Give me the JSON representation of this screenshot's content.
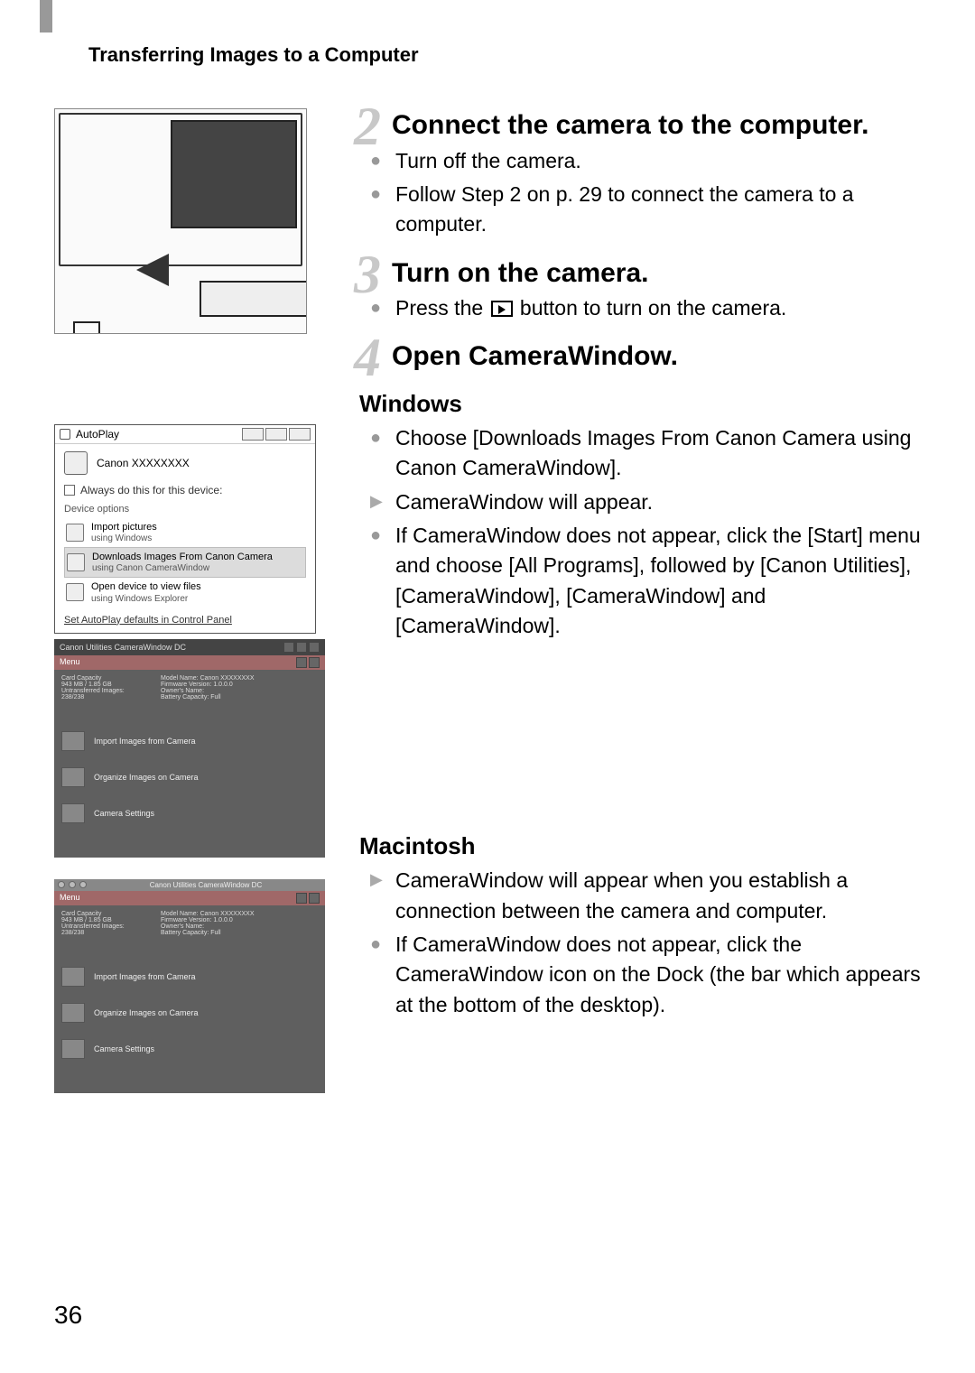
{
  "header": "Transferring Images to a Computer",
  "page_number": "36",
  "steps": {
    "s2": {
      "number": "2",
      "title": "Connect the camera to the computer.",
      "bullets": [
        [
          "Turn off the camera."
        ],
        [
          "Follow Step 2 on ",
          "p. 29",
          " to connect the camera to a computer."
        ]
      ]
    },
    "s3": {
      "number": "3",
      "title": "Turn on the camera.",
      "bullets": [
        [
          "Press the ",
          "PLAY_ICON",
          " button to turn on the camera."
        ]
      ]
    },
    "s4": {
      "number": "4",
      "title": "Open CameraWindow."
    }
  },
  "windows_section": {
    "title": "Windows",
    "bullets": [
      "Choose [Downloads Images From Canon Camera using Canon CameraWindow].",
      "If CameraWindow does not appear, click the [Start] menu and choose [All Programs], followed by [Canon Utilities], [CameraWindow], [CameraWindow] and [CameraWindow]."
    ],
    "triangle": "CameraWindow will appear."
  },
  "mac_section": {
    "title": "Macintosh",
    "triangle": "CameraWindow will appear when you establish a connection between the camera and computer.",
    "bullets": [
      "If CameraWindow does not appear, click the CameraWindow icon on the Dock (the bar which appears at the bottom of the desktop)."
    ]
  },
  "autoplay": {
    "title": "AutoPlay",
    "device": "Canon XXXXXXXX",
    "checkbox": "Always do this for this device:",
    "group": "Device options",
    "opt1_main": "Import pictures",
    "opt1_sub": "using Windows",
    "opt2_main": "Downloads Images From Canon Camera",
    "opt2_sub": "using Canon CameraWindow",
    "opt3_main": "Open device to view files",
    "opt3_sub": "using Windows Explorer",
    "link": "Set AutoPlay defaults in Control Panel"
  },
  "camerawindow": {
    "title": "Canon Utilities CameraWindow DC",
    "menu": "Menu",
    "info_left1": "Card Capacity",
    "info_left2": "943 MB / 1.85 GB",
    "info_left3": "Untransferred Images: 238/238",
    "info_r1": "Model Name: Canon XXXXXXXX",
    "info_r2": "Firmware Version: 1.0.0.0",
    "info_r3": "Owner's Name:",
    "info_r4": "Battery Capacity: Full",
    "action1": "Import Images from Camera",
    "action2": "Organize Images on Camera",
    "action3": "Camera Settings"
  }
}
